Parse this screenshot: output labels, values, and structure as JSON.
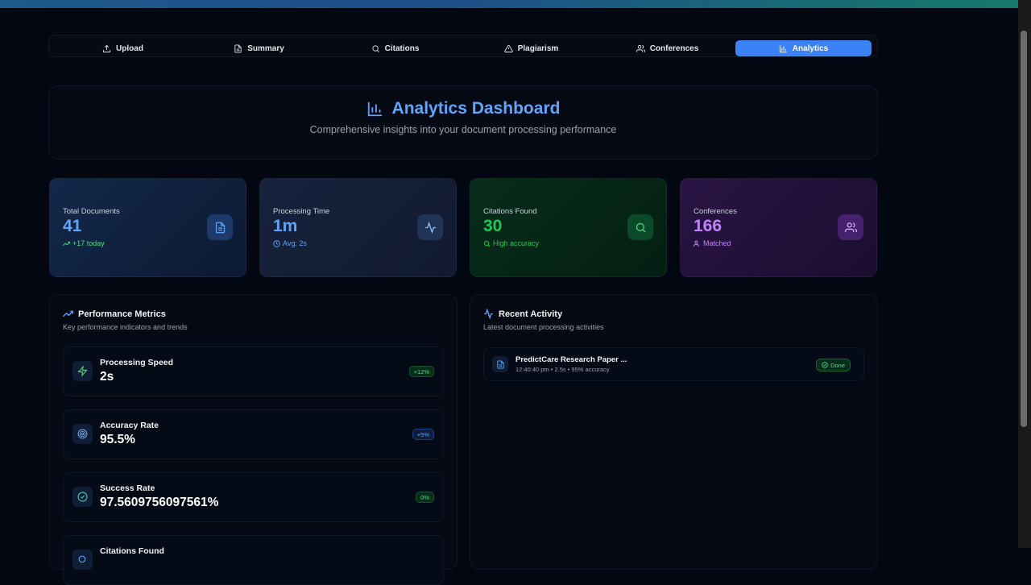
{
  "tabs": [
    {
      "label": "Upload",
      "icon": "upload-icon"
    },
    {
      "label": "Summary",
      "icon": "file-text-icon"
    },
    {
      "label": "Citations",
      "icon": "search-icon"
    },
    {
      "label": "Plagiarism",
      "icon": "alert-triangle-icon"
    },
    {
      "label": "Conferences",
      "icon": "users-icon"
    },
    {
      "label": "Analytics",
      "icon": "bar-chart-icon",
      "active": true
    }
  ],
  "hero": {
    "title": "Analytics Dashboard",
    "subtitle": "Comprehensive insights into your document processing performance"
  },
  "stats": [
    {
      "label": "Total Documents",
      "value": "41",
      "sub": "+17 today",
      "icon": "file-text-icon",
      "color": "#60a5fa"
    },
    {
      "label": "Processing Time",
      "value": "1m",
      "sub": "Avg: 2s",
      "icon": "activity-icon",
      "color": "#60a5fa"
    },
    {
      "label": "Citations Found",
      "value": "30",
      "sub": "High accuracy",
      "icon": "search-icon",
      "color": "#22c55e"
    },
    {
      "label": "Conferences",
      "value": "166",
      "sub": "Matched",
      "icon": "users-icon",
      "color": "#c084fc"
    }
  ],
  "performance": {
    "title": "Performance Metrics",
    "subtitle": "Key performance indicators and trends",
    "metrics": [
      {
        "name": "Processing Speed",
        "value": "2s",
        "badge": "+12%",
        "icon": "zap-icon"
      },
      {
        "name": "Accuracy Rate",
        "value": "95.5%",
        "badge": "+5%",
        "icon": "target-icon"
      },
      {
        "name": "Success Rate",
        "value": "97.5609756097561%",
        "badge": "0%",
        "icon": "check-circle-icon"
      },
      {
        "name": "Citations Found",
        "value": "",
        "badge": "",
        "icon": "quote-icon"
      }
    ]
  },
  "activity": {
    "title": "Recent Activity",
    "subtitle": "Latest document processing activities",
    "items": [
      {
        "name": "PredictCare Research Paper ...",
        "meta": "12:40:40 pm • 2.5s • 95% accuracy",
        "status": "Done"
      }
    ]
  },
  "colors": {
    "accent": "#3b82f6",
    "green": "#22c55e",
    "purple": "#c084fc"
  }
}
